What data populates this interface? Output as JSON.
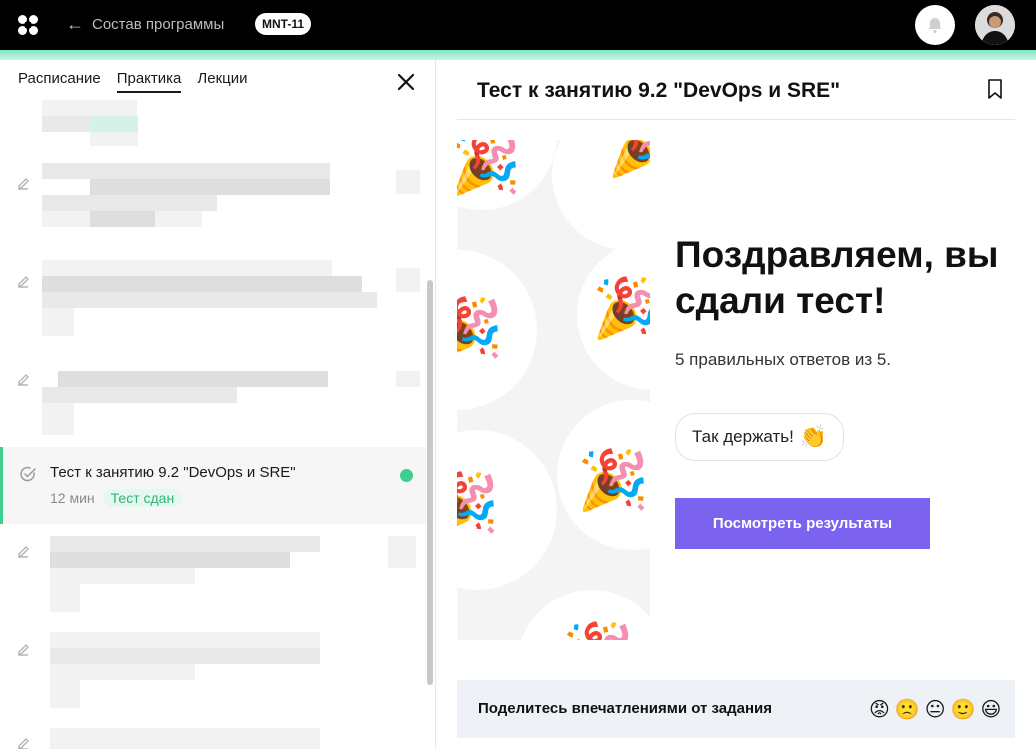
{
  "topbar": {
    "back_label": "Состав программы",
    "badge": "MNT-11",
    "logo_icon": "app-logo-icon",
    "notifications_icon": "bell-icon"
  },
  "sidebar": {
    "tabs": [
      {
        "label": "Расписание",
        "active": false
      },
      {
        "label": "Практика",
        "active": true
      },
      {
        "label": "Лекции",
        "active": false
      }
    ],
    "active_item": {
      "title": "Тест к занятию 9.2 \"DevOps и SRE\"",
      "duration": "12 мин",
      "status": "Тест сдан"
    }
  },
  "content": {
    "title": "Тест к занятию 9.2 \"DevOps и SRE\"",
    "headline": "Поздравляем, вы сдали тест!",
    "score_text": "5 правильных ответов из 5.",
    "bubble_text": "Так держать!",
    "bubble_emoji": "👏",
    "results_button": "Посмотреть результаты"
  },
  "feedback": {
    "label": "Поделитесь впечатлениями от задания",
    "emojis": [
      "😡",
      "🙁",
      "😐",
      "🙂",
      "😃"
    ]
  },
  "colors": {
    "accent_green": "#3ecf8e",
    "button_purple": "#7b63f0",
    "topbar": "#000000"
  }
}
